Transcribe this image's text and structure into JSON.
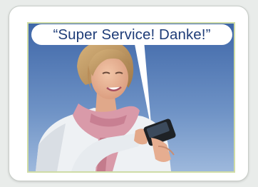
{
  "quote": "“Super Service! Danke!”",
  "colors": {
    "page_background": "#e9ecea",
    "card_background": "#ffffff",
    "frame_border": "#cfdca6",
    "sky": "#5a7fb6",
    "quote_text": "#1f3d78"
  },
  "photo": {
    "subject": "smiling woman in a white top and pink scarf texting on a smartphone under a blue sky"
  }
}
